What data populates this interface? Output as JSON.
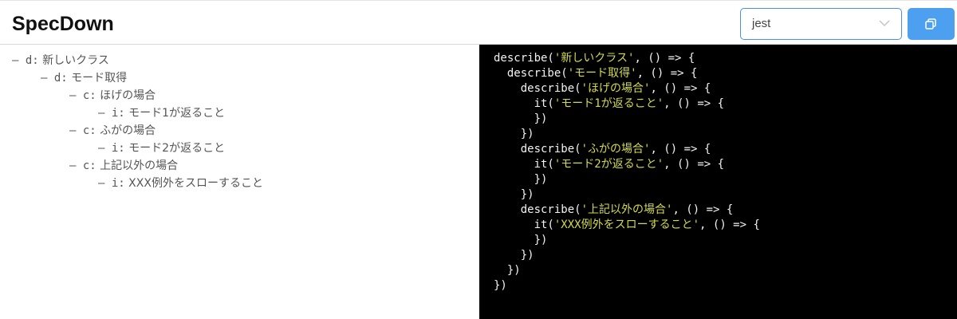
{
  "app": {
    "title": "SpecDown"
  },
  "toolbar": {
    "framework_value": "jest",
    "framework_dropdown_icon": "chevron-down-icon",
    "copy_button_icon": "copy-icon"
  },
  "outline": [
    {
      "prefix": "– d:",
      "text": "新しいクラス",
      "indent": 0
    },
    {
      "prefix": "– d:",
      "text": "モード取得",
      "indent": 1
    },
    {
      "prefix": "– c:",
      "text": "ほげの場合",
      "indent": 2
    },
    {
      "prefix": "– i:",
      "text": "モード1が返ること",
      "indent": 3
    },
    {
      "prefix": "– c:",
      "text": "ふがの場合",
      "indent": 2
    },
    {
      "prefix": "– i:",
      "text": "モード2が返ること",
      "indent": 3
    },
    {
      "prefix": "– c:",
      "text": "上記以外の場合",
      "indent": 2
    },
    {
      "prefix": "– i:",
      "text": "XXX例外をスローすること",
      "indent": 3
    }
  ],
  "code": [
    {
      "indent": "",
      "pre": "describe(",
      "str": "'新しいクラス'",
      "post": ", () => {"
    },
    {
      "indent": "  ",
      "pre": "describe(",
      "str": "'モード取得'",
      "post": ", () => {"
    },
    {
      "indent": "    ",
      "pre": "describe(",
      "str": "'ほげの場合'",
      "post": ", () => {"
    },
    {
      "indent": "      ",
      "pre": "it(",
      "str": "'モード1が返ること'",
      "post": ", () => {"
    },
    {
      "indent": "      ",
      "pre": "})",
      "str": "",
      "post": ""
    },
    {
      "indent": "    ",
      "pre": "})",
      "str": "",
      "post": ""
    },
    {
      "indent": "    ",
      "pre": "describe(",
      "str": "'ふがの場合'",
      "post": ", () => {"
    },
    {
      "indent": "      ",
      "pre": "it(",
      "str": "'モード2が返ること'",
      "post": ", () => {"
    },
    {
      "indent": "      ",
      "pre": "})",
      "str": "",
      "post": ""
    },
    {
      "indent": "    ",
      "pre": "})",
      "str": "",
      "post": ""
    },
    {
      "indent": "    ",
      "pre": "describe(",
      "str": "'上記以外の場合'",
      "post": ", () => {"
    },
    {
      "indent": "      ",
      "pre": "it(",
      "str": "'XXX例外をスローすること'",
      "post": ", () => {"
    },
    {
      "indent": "      ",
      "pre": "})",
      "str": "",
      "post": ""
    },
    {
      "indent": "    ",
      "pre": "})",
      "str": "",
      "post": ""
    },
    {
      "indent": "  ",
      "pre": "})",
      "str": "",
      "post": ""
    },
    {
      "indent": "",
      "pre": "})",
      "str": "",
      "post": ""
    }
  ]
}
